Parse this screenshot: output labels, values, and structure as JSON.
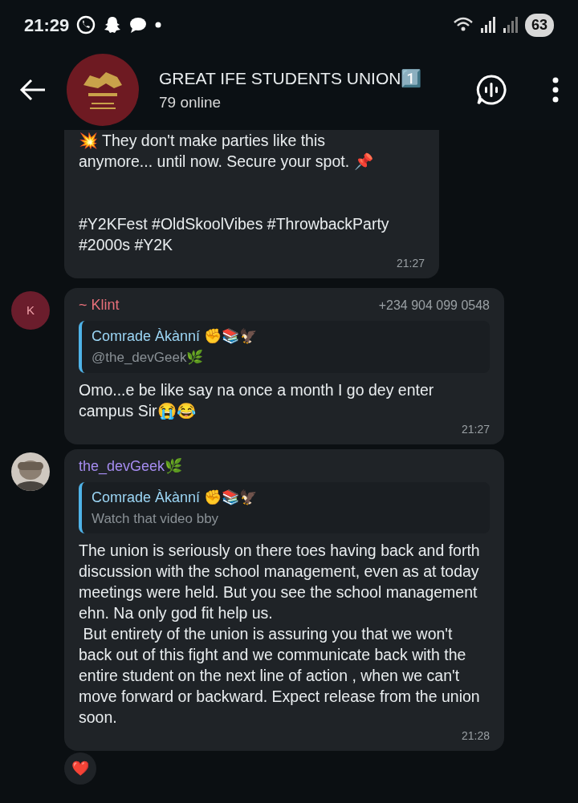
{
  "status_bar": {
    "time": "21:29",
    "battery": "63"
  },
  "header": {
    "title": "GREAT IFE STUDENTS UNION1️⃣",
    "subtitle": "79 online"
  },
  "messages": [
    {
      "kind": "continuation",
      "lines": [
        "💥 They don't make parties like this\nanymore... until now. Secure your spot. 📌\n\n\n#Y2KFest #OldSkoolVibes #ThrowbackParty #2000s #Y2K"
      ],
      "time": "21:27"
    },
    {
      "kind": "reply",
      "avatar": {
        "kind": "letter",
        "letter": "K"
      },
      "sender": "~ Klint",
      "color": "#e8707a",
      "phone": "+234 904 099 0548",
      "quote": {
        "author": "Comrade Àkànní ✊📚🦅",
        "text": "@the_devGeek🌿"
      },
      "lines": [
        "Omo...e be like say na once a month I go dey enter campus Sir😭😂"
      ],
      "time": "21:27"
    },
    {
      "kind": "reply",
      "sender": "the_devGeek🌿",
      "color": "#a58cf0",
      "quote": {
        "author": "Comrade Àkànní ✊📚🦅",
        "text": "Watch that video bby"
      },
      "lines": [
        "The union is seriously on there toes having back and forth discussion with the school management, even as at today meetings were held. But you see the school management ehn. Na only god fit help us.\n But entirety of the union is assuring you that we won't back out of this fight and we communicate back with the entire student on the next line of action , when we can't move forward or backward. Expect release from the union soon."
      ],
      "time": "21:28",
      "reaction": "❤️"
    }
  ]
}
